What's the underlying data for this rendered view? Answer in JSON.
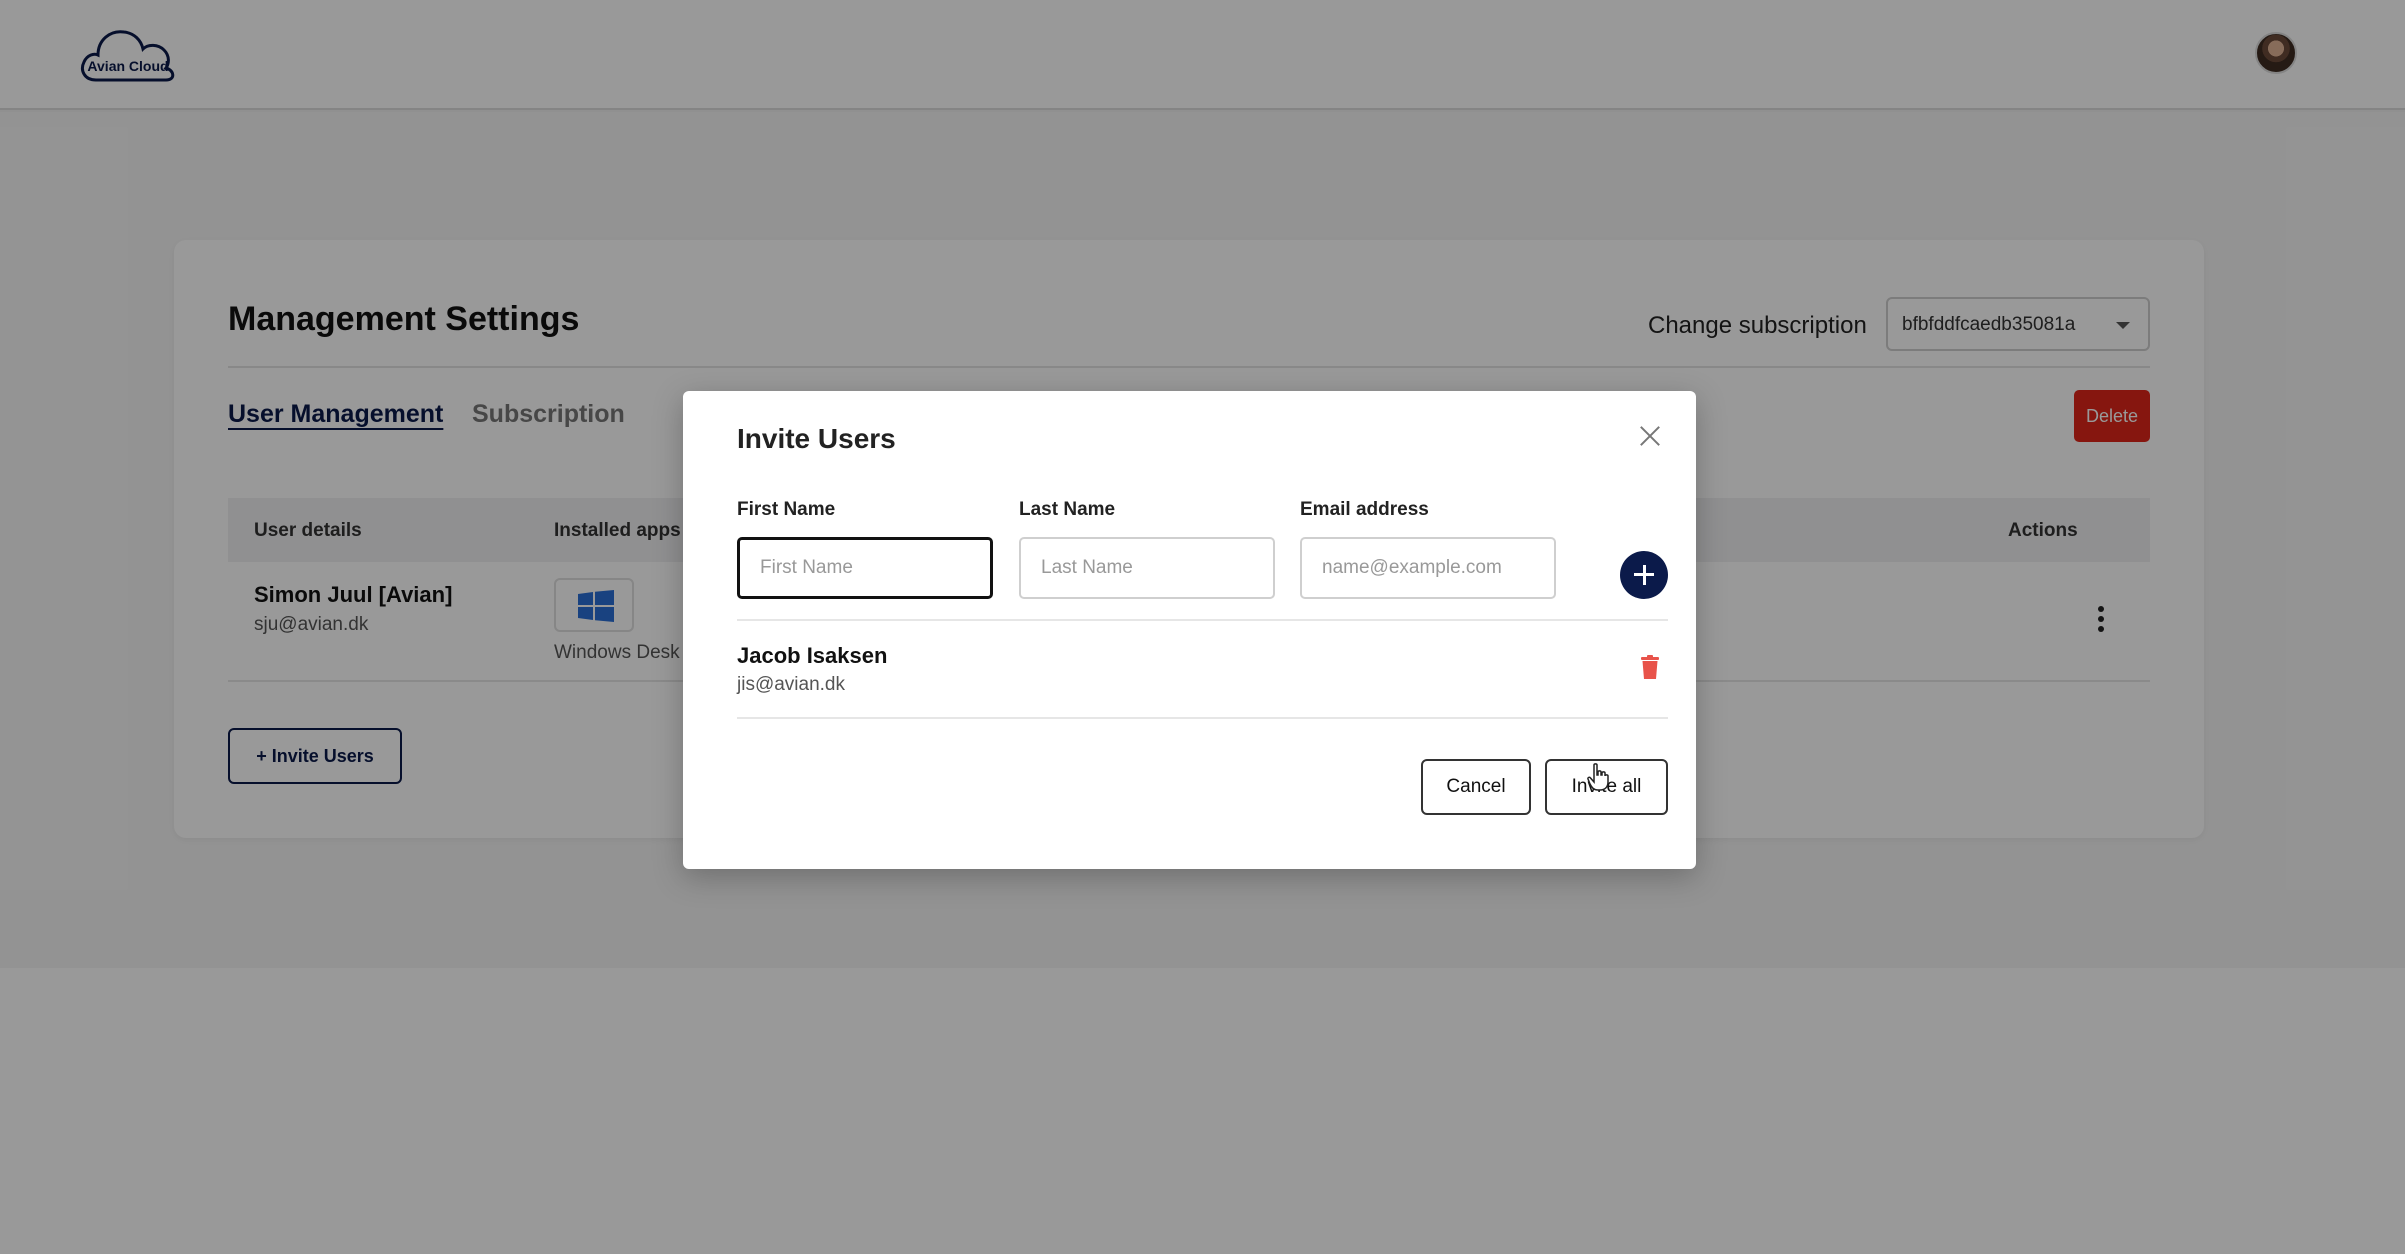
{
  "header": {
    "logo_text": "Avian Cloud",
    "logo_icon": "cloud-icon",
    "avatar_icon": "user-avatar"
  },
  "settings": {
    "title": "Management Settings",
    "change_subscription_label": "Change subscription",
    "subscription_value": "bfbfddfcaedb35081a",
    "tabs": [
      {
        "label": "User Management",
        "active": true
      },
      {
        "label": "Subscription",
        "active": false
      }
    ],
    "delete_label": "Delete",
    "table": {
      "columns": [
        "User details",
        "Installed apps",
        "Actions"
      ],
      "rows": [
        {
          "name": "Simon Juul [Avian]",
          "email": "sju@avian.dk",
          "app_label": "Windows Desk",
          "app_icon": "windows-icon"
        }
      ]
    },
    "invite_users_label": "+ Invite Users"
  },
  "modal": {
    "title": "Invite Users",
    "fields": {
      "first_name": {
        "label": "First Name",
        "placeholder": "First Name",
        "value": ""
      },
      "last_name": {
        "label": "Last Name",
        "placeholder": "Last Name",
        "value": ""
      },
      "email": {
        "label": "Email address",
        "placeholder": "name@example.com",
        "value": ""
      }
    },
    "invitees": [
      {
        "name": "Jacob Isaksen",
        "email": "jis@avian.dk"
      }
    ],
    "cancel_label": "Cancel",
    "invite_all_label": "Invite all"
  },
  "colors": {
    "brand_navy": "#0b1a4a",
    "danger_red": "#e0261a",
    "trash_red": "#e8534a"
  }
}
